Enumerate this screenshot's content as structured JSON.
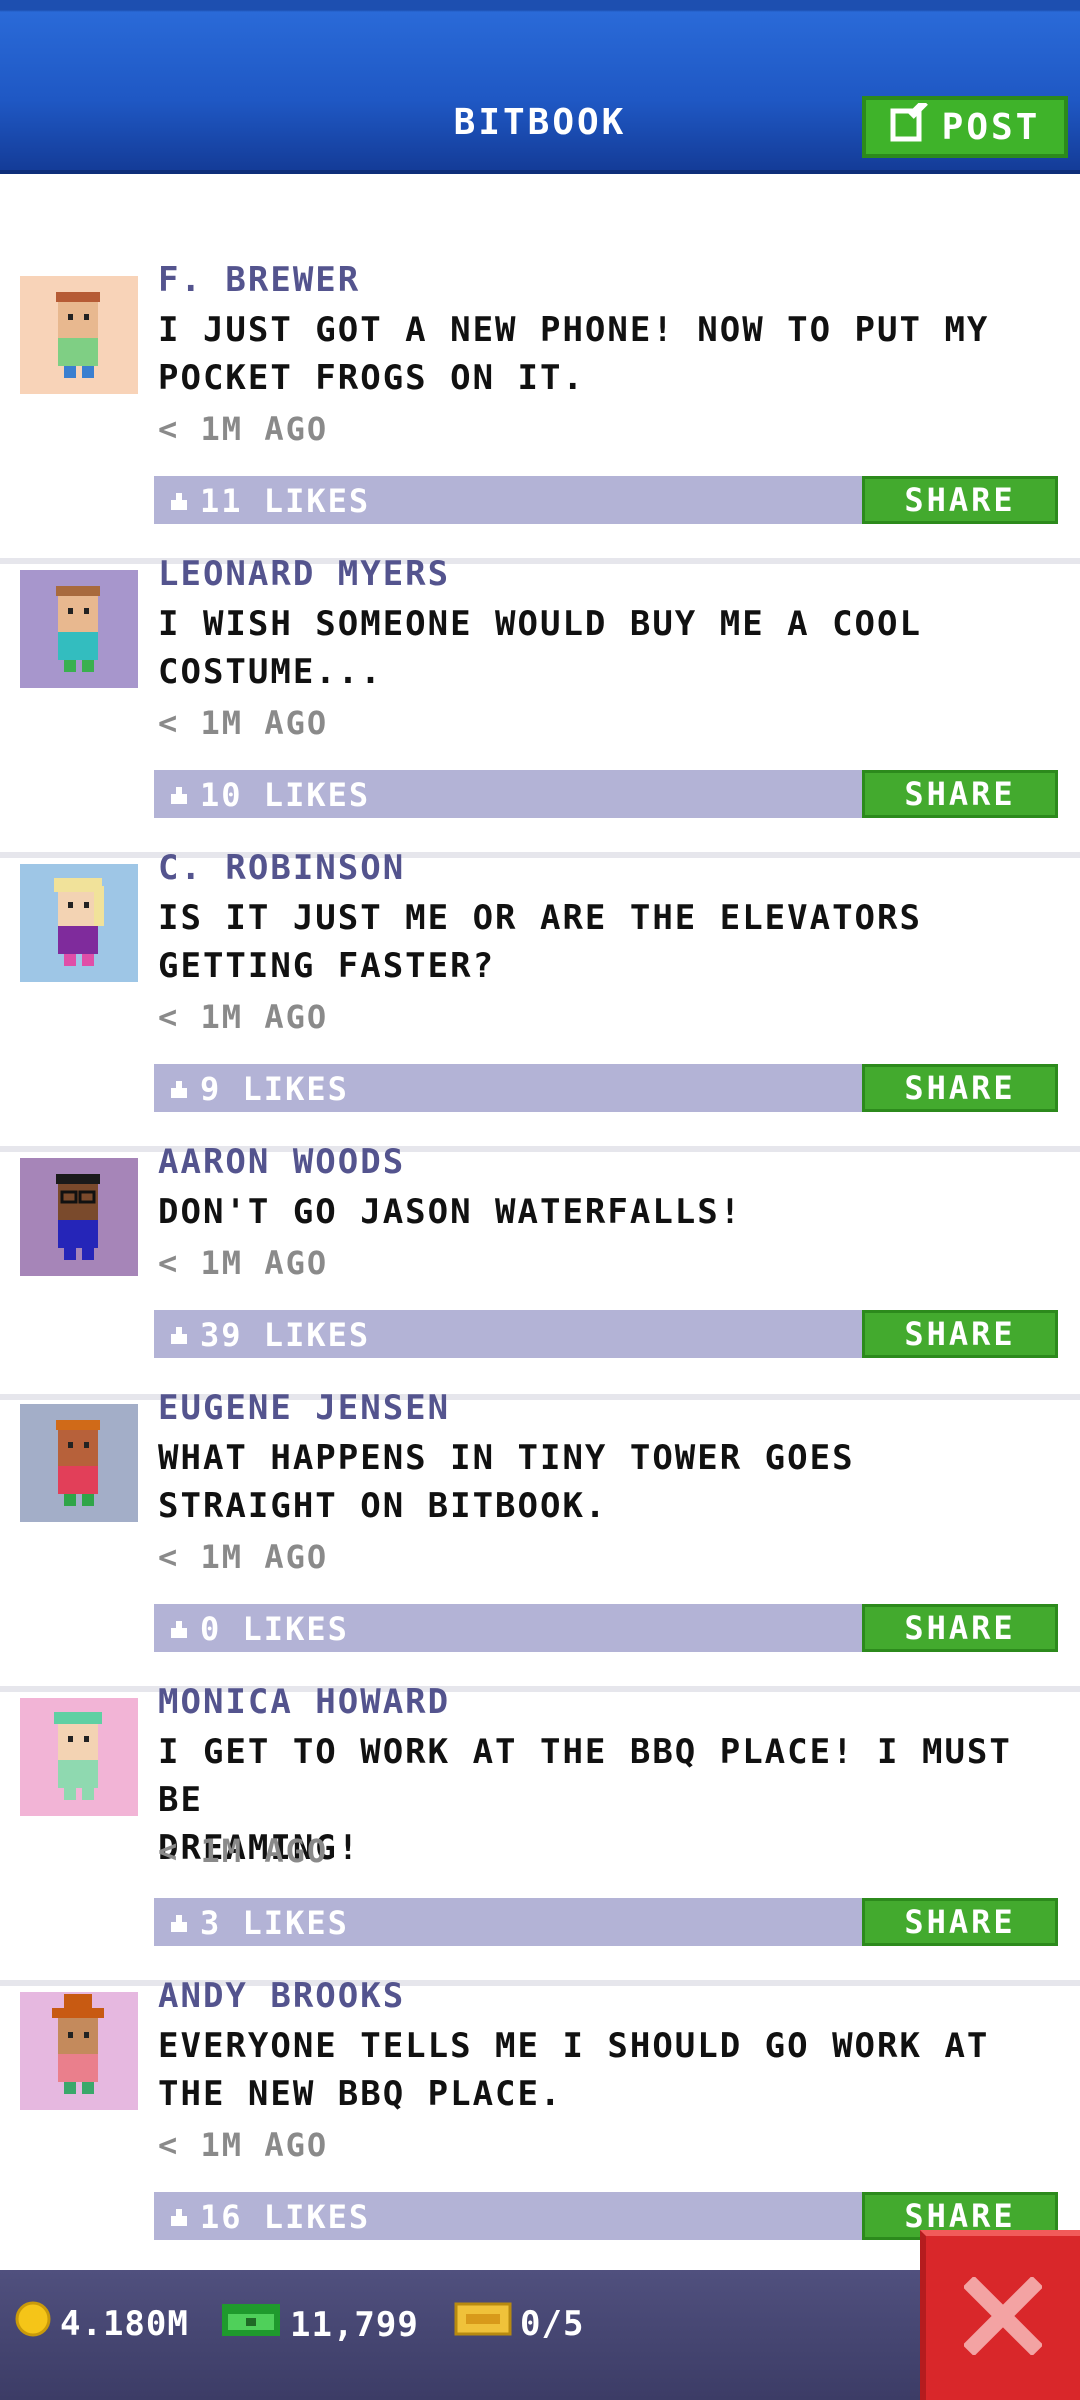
{
  "header": {
    "title": "BITBOOK",
    "post_label": "POST"
  },
  "posts": [
    {
      "name": "F. BREWER",
      "line1": "I JUST GOT A NEW PHONE! NOW TO PUT MY",
      "line2": "POCKET FROGS ON IT.",
      "time": "< 1M AGO",
      "likes": "11 LIKES",
      "share": "SHARE"
    },
    {
      "name": "LEONARD MYERS",
      "line1": "I WISH SOMEONE WOULD BUY ME A COOL",
      "line2": "COSTUME...",
      "time": "< 1M AGO",
      "likes": "10 LIKES",
      "share": "SHARE"
    },
    {
      "name": "C. ROBINSON",
      "line1": "IS IT JUST ME OR ARE THE ELEVATORS",
      "line2": "GETTING FASTER?",
      "time": "< 1M AGO",
      "likes": "9 LIKES",
      "share": "SHARE"
    },
    {
      "name": "AARON WOODS",
      "line1": "DON'T GO JASON WATERFALLS!",
      "line2": "",
      "time": "< 1M AGO",
      "likes": "39 LIKES",
      "share": "SHARE"
    },
    {
      "name": "EUGENE JENSEN",
      "line1": "WHAT HAPPENS IN TINY TOWER GOES",
      "line2": "STRAIGHT ON BITBOOK.",
      "time": "< 1M AGO",
      "likes": "0 LIKES",
      "share": "SHARE"
    },
    {
      "name": "MONICA HOWARD",
      "line1": "I GET TO WORK AT THE BBQ PLACE! I MUST BE",
      "line2": "DREAMING!",
      "time": "< 1M AGO",
      "likes": "3 LIKES",
      "share": "SHARE"
    },
    {
      "name": "ANDY BROOKS",
      "line1": "EVERYONE TELLS ME I SHOULD GO WORK AT",
      "line2": "THE NEW BBQ PLACE.",
      "time": "< 1M AGO",
      "likes": "16 LIKES",
      "share": "SHARE"
    }
  ],
  "footer": {
    "coins": "4.180M",
    "bux": "11,799",
    "tickets": "0/5"
  },
  "colors": {
    "header": "#1f58c4",
    "accent_green": "#43aa2e",
    "likes_bar": "#b3b3d6",
    "name": "#54548e",
    "close": "#d9272a"
  },
  "icons": {
    "post": "edit-icon",
    "like": "thumb-icon",
    "coin": "coin-icon",
    "bux": "bux-icon",
    "ticket": "ticket-icon",
    "close": "close-icon"
  }
}
